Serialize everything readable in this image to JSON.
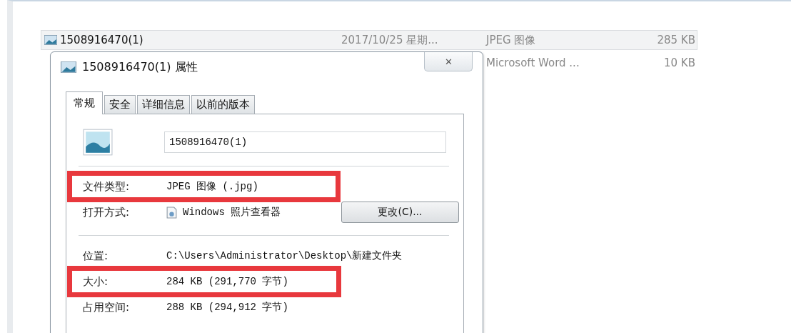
{
  "files": [
    {
      "name": "1508916470(1)",
      "date": "2017/10/25 星期...",
      "type": "JPEG 图像",
      "size": "285 KB",
      "selected": true
    },
    {
      "type": "Microsoft Word ...",
      "size": "10 KB",
      "selected": false
    }
  ],
  "dialog": {
    "title": "1508916470(1) 属性",
    "close": "✕",
    "tabs": [
      {
        "label": "常规",
        "selected": true
      },
      {
        "label": "安全",
        "selected": false
      },
      {
        "label": "详细信息",
        "selected": false
      },
      {
        "label": "以前的版本",
        "selected": false
      }
    ],
    "file_name": "1508916470(1)",
    "rows": [
      {
        "kind": "separator"
      },
      {
        "kind": "field",
        "label": "文件类型:",
        "value": "JPEG 图像 (.jpg)",
        "highlighted": true
      },
      {
        "kind": "app",
        "label": "打开方式:",
        "value": "Windows 照片查看器",
        "button": "更改(C)...",
        "highlighted": false
      },
      {
        "kind": "separator"
      },
      {
        "kind": "field",
        "label": "位置:",
        "value": "C:\\Users\\Administrator\\Desktop\\新建文件夹",
        "highlighted": false
      },
      {
        "kind": "field",
        "label": "大小:",
        "value": "284 KB (291,770 字节)",
        "highlighted": true
      },
      {
        "kind": "field",
        "label": "占用空间:",
        "value": "288 KB (294,912 字节)",
        "highlighted": false
      }
    ]
  }
}
